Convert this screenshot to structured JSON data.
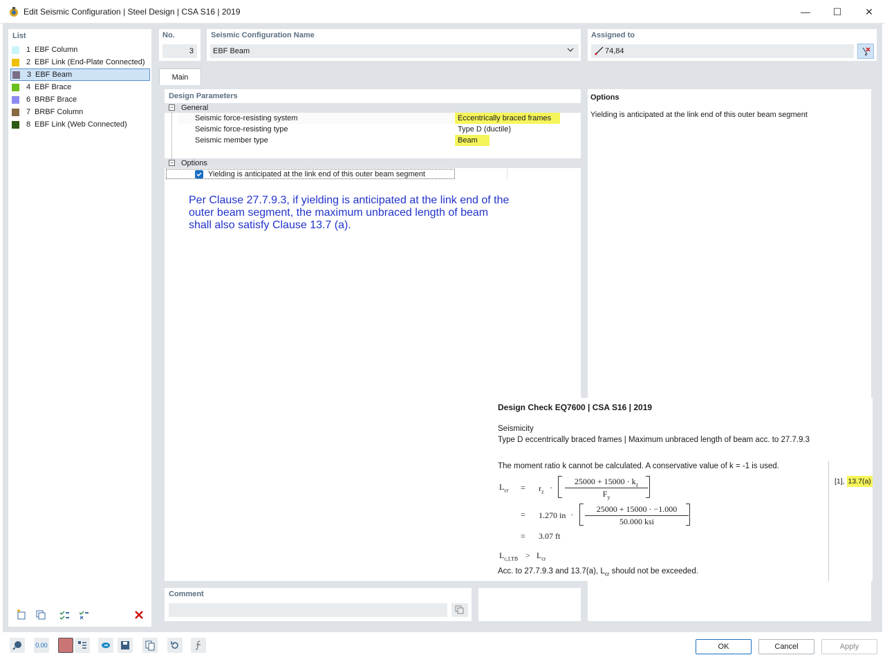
{
  "window": {
    "title": "Edit Seismic Configuration | Steel Design | CSA S16 | 2019",
    "minimize": "—",
    "maximize": "☐",
    "close": "✕"
  },
  "list": {
    "header": "List",
    "items": [
      {
        "num": "1",
        "label": "EBF Column",
        "color": "#c8f4f8"
      },
      {
        "num": "2",
        "label": "EBF Link (End-Plate Connected)",
        "color": "#f0c000"
      },
      {
        "num": "3",
        "label": "EBF Beam",
        "color": "#7a6f86"
      },
      {
        "num": "4",
        "label": "EBF Brace",
        "color": "#6cc01e"
      },
      {
        "num": "6",
        "label": "BRBF Brace",
        "color": "#8c8cf0"
      },
      {
        "num": "7",
        "label": "BRBF Column",
        "color": "#8a6a40"
      },
      {
        "num": "8",
        "label": "EBF Link (Web Connected)",
        "color": "#2e5a14"
      }
    ],
    "selected_index": 2
  },
  "no": {
    "header": "No.",
    "value": "3"
  },
  "name": {
    "header": "Seismic Configuration Name",
    "value": "EBF Beam"
  },
  "assigned": {
    "header": "Assigned to",
    "value": "74,84"
  },
  "tabs": {
    "main": "Main"
  },
  "design_params": {
    "header": "Design Parameters",
    "general": "General",
    "rows": [
      {
        "label": "Seismic force-resisting system",
        "value": "Eccentrically braced frames"
      },
      {
        "label": "Seismic force-resisting type",
        "value": "Type D (ductile)"
      },
      {
        "label": "Seismic member type",
        "value": "Beam"
      }
    ],
    "options": "Options",
    "option_row": "Yielding is anticipated at the link end of this outer beam segment",
    "annotation": "Per Clause 27.7.9.3, if yielding is anticipated at the link end of the outer beam segment, the maximum unbraced length of beam shall also satisfy Clause 13.7 (a)."
  },
  "options_panel": {
    "header": "Options",
    "text": "Yielding is anticipated at the link end of this outer beam segment"
  },
  "design_check": {
    "title": "Design Check EQ7600 | CSA S16 | 2019",
    "seismicity": "Seismicity",
    "description": "Type D eccentrically braced frames | Maximum unbraced length of beam acc. to 27.7.9.3",
    "moment_note": "The moment ratio k cannot be calculated. A conservative value of k = -1 is used.",
    "lcr": "L",
    "lcr_sub": "cr",
    "eq": "=",
    "rz": "r",
    "rz_sub": "z",
    "dot": "·",
    "num1_a": "25000",
    "plus": "+",
    "num1_b": "15000",
    "kz": "k",
    "kz_sub": "z",
    "fy": "F",
    "fy_sub": "y",
    "rz_val": "1.270 in",
    "num2_b": "15000",
    "k_val": "−1.000",
    "den2": "50.000 ksi",
    "result": "3.07 ft",
    "cond_left": "L",
    "cond_left_sub": "c,LTB",
    "gt": ">",
    "ref": "[1],",
    "ref_clause": "13.7(a)",
    "conclusion_a": "Acc. to 27.7.9.3 and 13.7(a), L",
    "conclusion_sub": "cr",
    "conclusion_b": " should not be exceeded."
  },
  "comment": {
    "header": "Comment",
    "value": ""
  },
  "footer": {
    "ok": "OK",
    "cancel": "Cancel",
    "apply": "Apply",
    "decimal_icon": "0.00"
  },
  "colors": {
    "accent": "#0063b1",
    "highlight": "#f5f55a",
    "annotation": "#2233cc"
  }
}
